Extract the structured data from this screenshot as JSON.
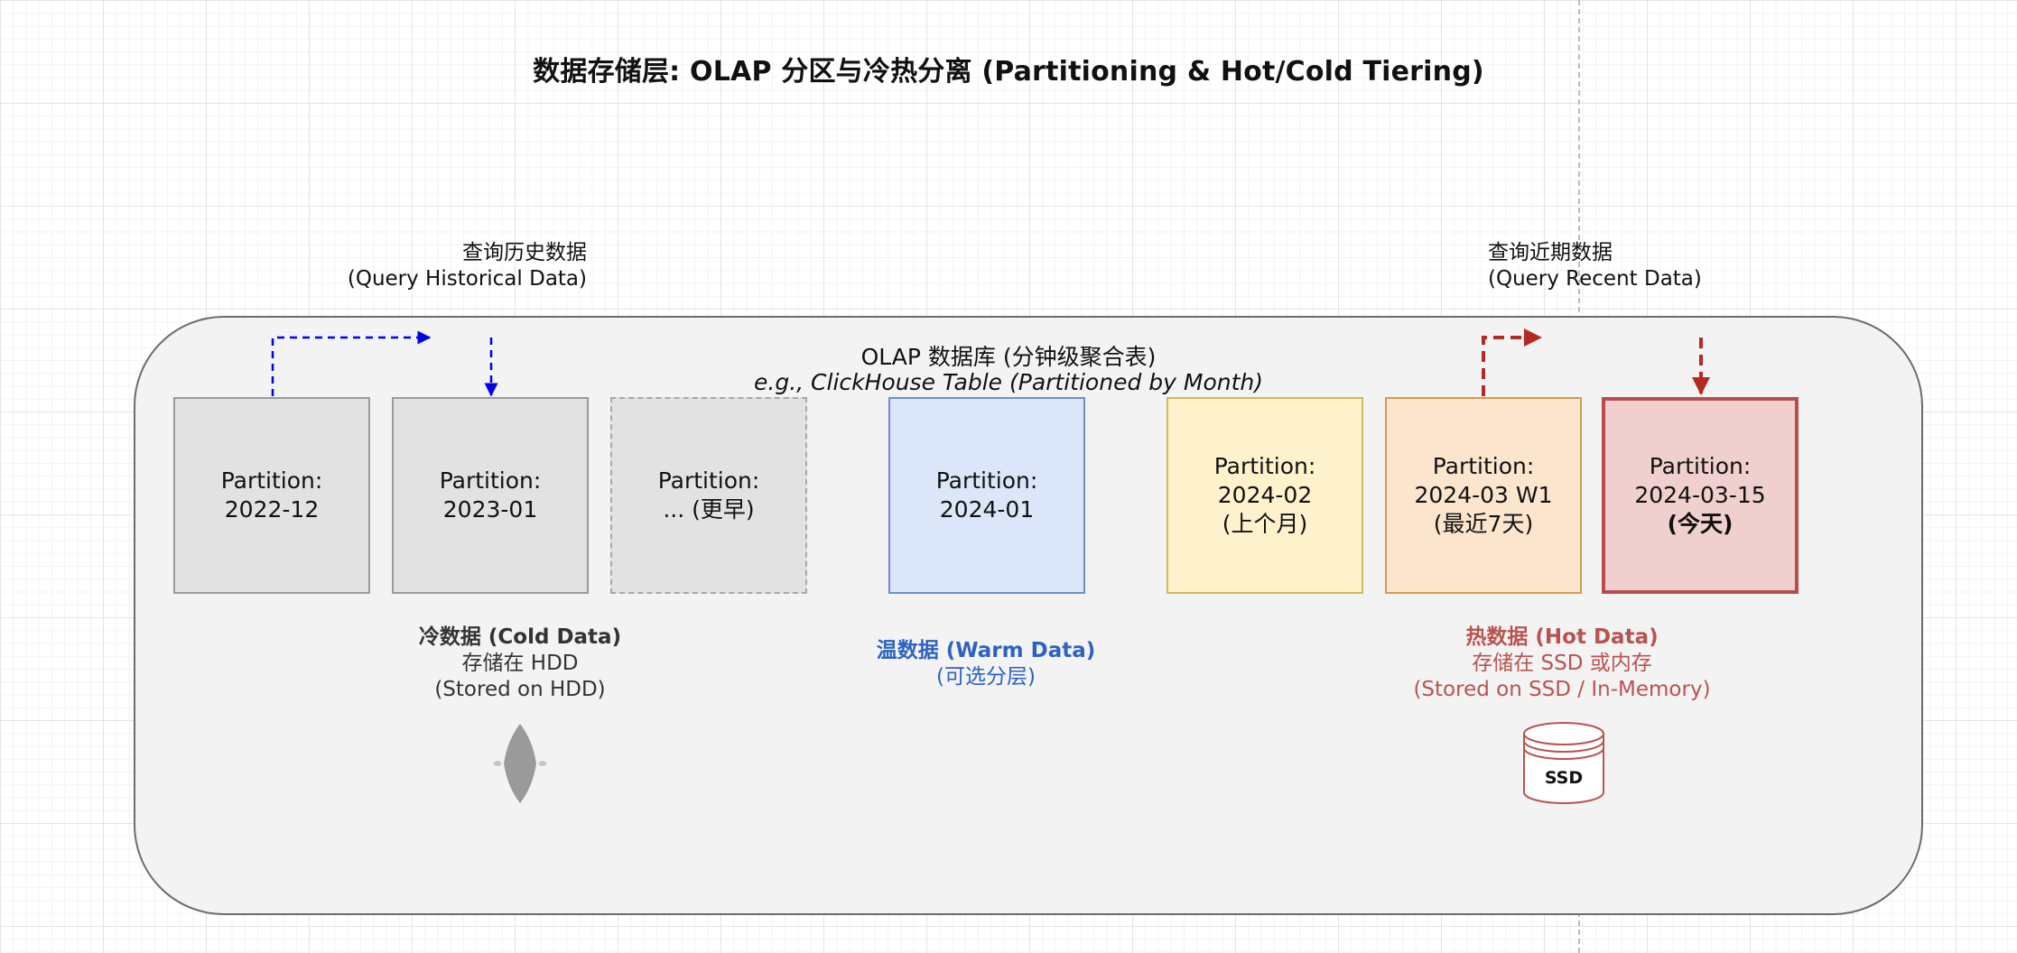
{
  "title": "数据存储层: OLAP 分区与冷热分离 (Partitioning & Hot/Cold Tiering)",
  "database": {
    "title": "OLAP 数据库 (分钟级聚合表)",
    "subtitle": "e.g., ClickHouse Table (Partitioned by Month)"
  },
  "queries": {
    "historical": {
      "line1": "查询历史数据",
      "line2": "(Query Historical Data)"
    },
    "recent": {
      "line1": "查询近期数据",
      "line2": "(Query Recent Data)"
    }
  },
  "partitions": [
    {
      "line1": "Partition:",
      "line2": "2022-12",
      "line3": ""
    },
    {
      "line1": "Partition:",
      "line2": "2023-01",
      "line3": ""
    },
    {
      "line1": "Partition:",
      "line2": "... (更早)",
      "line3": ""
    },
    {
      "line1": "Partition:",
      "line2": "2024-01",
      "line3": ""
    },
    {
      "line1": "Partition:",
      "line2": "2024-02",
      "line3": "(上个月)"
    },
    {
      "line1": "Partition:",
      "line2": "2024-03 W1",
      "line3": "(最近7天)"
    },
    {
      "line1": "Partition:",
      "line2": "2024-03-15",
      "line3": "(今天)"
    }
  ],
  "tiers": {
    "cold": {
      "name": "冷数据 (Cold Data)",
      "line2": "存储在 HDD",
      "line3": "(Stored on HDD)"
    },
    "warm": {
      "name": "温数据 (Warm Data)",
      "line2": "(可选分层)"
    },
    "hot": {
      "name": "热数据 (Hot Data)",
      "line2": "存储在 SSD 或内存",
      "line3": "(Stored on SSD / In-Memory)"
    }
  },
  "icons": {
    "hdd": "hdd-disk-icon",
    "ssd": {
      "name": "ssd-cylinder-icon",
      "label": "SSD"
    }
  },
  "colors": {
    "cold_arrow": "#0000ee",
    "hot_arrow": "#b52a22",
    "warm_text": "#2d63c0",
    "hot_text": "#b85450"
  }
}
